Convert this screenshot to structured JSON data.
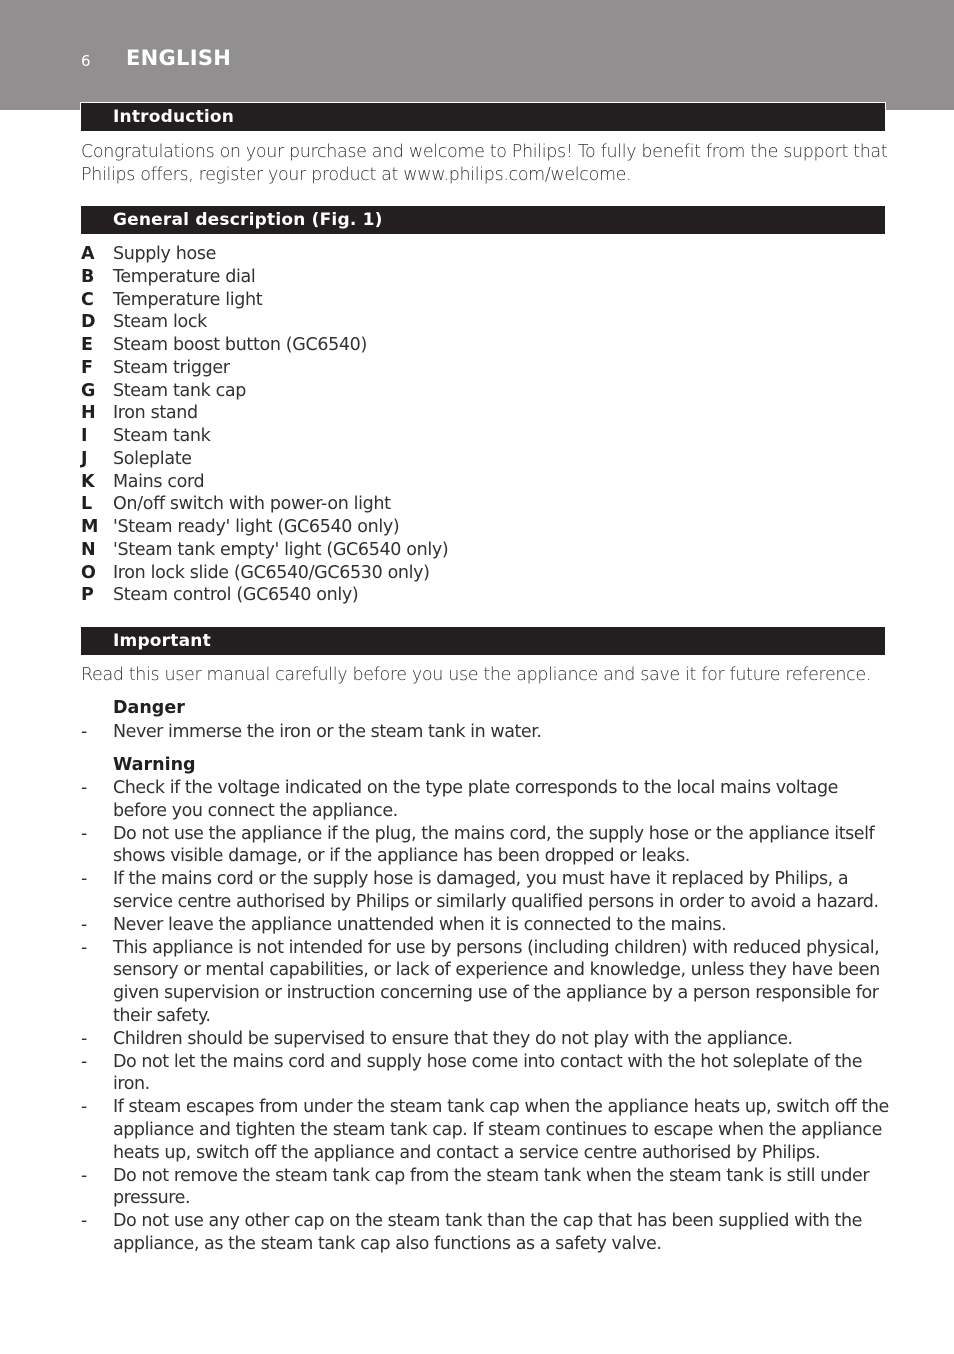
{
  "header": {
    "page_number": "6",
    "language": "ENGLISH"
  },
  "sections": {
    "introduction": {
      "title": "Introduction",
      "text": "Congratulations on your purchase and welcome to Philips! To fully benefit from the support that Philips offers, register your product at www.philips.com/welcome."
    },
    "general_description": {
      "title": "General description (Fig. 1)",
      "items": [
        {
          "letter": "A",
          "label": "Supply hose"
        },
        {
          "letter": "B",
          "label": "Temperature dial"
        },
        {
          "letter": "C",
          "label": "Temperature light"
        },
        {
          "letter": "D",
          "label": "Steam lock"
        },
        {
          "letter": "E",
          "label": "Steam boost button (GC6540)"
        },
        {
          "letter": "F",
          "label": "Steam trigger"
        },
        {
          "letter": "G",
          "label": "Steam tank cap"
        },
        {
          "letter": "H",
          "label": "Iron stand"
        },
        {
          "letter": "I",
          "label": "Steam tank"
        },
        {
          "letter": "J",
          "label": "Soleplate"
        },
        {
          "letter": "K",
          "label": "Mains cord"
        },
        {
          "letter": "L",
          "label": "On/off switch with power-on light"
        },
        {
          "letter": "M",
          "label": "'Steam ready' light (GC6540 only)"
        },
        {
          "letter": "N",
          "label": "'Steam tank empty' light (GC6540 only)"
        },
        {
          "letter": "O",
          "label": "Iron lock slide (GC6540/GC6530 only)"
        },
        {
          "letter": "P",
          "label": "Steam control (GC6540 only)"
        }
      ]
    },
    "important": {
      "title": "Important",
      "text": "Read this user manual carefully before you use the appliance and save it for future reference.",
      "danger": {
        "title": "Danger",
        "items": [
          "Never immerse the iron or the steam tank in water."
        ]
      },
      "warning": {
        "title": "Warning",
        "items": [
          "Check if the voltage indicated on the type plate corresponds to the local mains voltage before you connect the appliance.",
          "Do not use the appliance if the plug, the mains cord, the supply hose or the appliance itself shows visible damage, or if the appliance has been dropped or leaks.",
          "If the mains cord or the supply hose is damaged, you must have it replaced by Philips, a service centre authorised by Philips or similarly qualified persons in order to avoid a hazard.",
          "Never leave the appliance unattended when it is connected to the mains.",
          "This appliance is not intended for use by persons (including children) with reduced physical, sensory or mental capabilities, or lack of experience and knowledge, unless they have been given supervision or instruction concerning use of the appliance by a person responsible for their safety.",
          "Children should be supervised to ensure that they do not play with the appliance.",
          "Do not let the mains cord and supply hose come into contact with the hot soleplate of the iron.",
          "If steam escapes from under the steam tank cap when the appliance heats up, switch off the appliance and tighten the steam tank cap. If steam continues to escape when the appliance heats up, switch off the appliance and contact a service centre authorised by Philips.",
          "Do not remove the steam tank cap from the steam tank when the steam tank is still under pressure.",
          "Do not use any other cap on the steam tank than the cap that has been supplied with the appliance, as the steam tank cap also functions as a safety valve."
        ]
      }
    }
  },
  "bullet_marker": "-"
}
